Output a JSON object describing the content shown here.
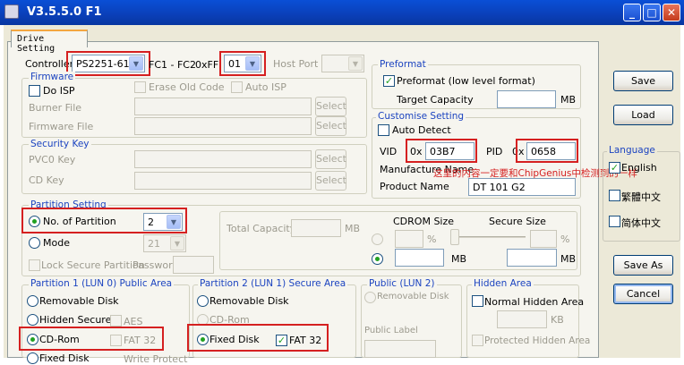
{
  "window": {
    "title": "V3.5.5.0 F1",
    "min": "_",
    "max": "□",
    "close": "✕"
  },
  "tab": {
    "label": "Drive Setting"
  },
  "controller": {
    "label": "Controller",
    "value": "PS2251-61",
    "fc_label": "FC1 - FC2",
    "ff_label": "0xFF",
    "ff_value": "01",
    "host_port_label": "Host Port"
  },
  "firmware": {
    "title": "Firmware",
    "do_isp": "Do ISP",
    "erase_old_code": "Erase Old Code",
    "auto_isp": "Auto ISP",
    "burner_file": "Burner File",
    "firmware_file": "Firmware File",
    "select": "Select"
  },
  "security": {
    "title": "Security Key",
    "pvc0": "PVC0 Key",
    "cd_key": "CD Key",
    "select": "Select"
  },
  "partition": {
    "title": "Partition Setting",
    "no_partition": "No. of Partition",
    "no_value": "2",
    "mode": "Mode",
    "mode_value": "21",
    "lock_secure": "Lock Secure Partition",
    "password": "Password",
    "total_capacity": "Total Capacity",
    "mb": "MB",
    "cdrom_size": "CDROM Size",
    "secure_size": "Secure Size",
    "percent": "%"
  },
  "preformat": {
    "title": "Preformat",
    "option": "Preformat (low level format)",
    "target_capacity": "Target Capacity",
    "mb": "MB"
  },
  "customise": {
    "title": "Customise Setting",
    "auto_detect": "Auto Detect",
    "vid": "VID",
    "vid_prefix": "0x",
    "vid_value": "03B7",
    "pid": "PID",
    "pid_prefix": "0x",
    "pid_value": "0658",
    "manufacture": "Manufacture Name",
    "product_name": "Product Name",
    "product_value": "DT  101  G2",
    "note": "这里的内容一定要和ChipGenius中检测到的一样"
  },
  "lun0": {
    "title": "Partition 1 (LUN 0) Public Area",
    "removable": "Removable Disk",
    "hidden_secure": "Hidden Secure",
    "aes": "AES",
    "cdrom": "CD-Rom",
    "fat32": "FAT 32",
    "fixed_disk": "Fixed Disk",
    "write_protect": "Write Protect"
  },
  "lun1": {
    "title": "Partition 2 (LUN 1) Secure Area",
    "removable": "Removable Disk",
    "cdrom": "CD-Rom",
    "fixed_disk": "Fixed Disk",
    "fat32": "FAT 32"
  },
  "lun2": {
    "title": "Public (LUN 2)",
    "removable": "Removable Disk",
    "public_label": "Public Label"
  },
  "hidden": {
    "title": "Hidden Area",
    "normal": "Normal Hidden Area",
    "kb": "KB",
    "protected": "Protected Hidden Area"
  },
  "buttons": {
    "save": "Save",
    "load": "Load",
    "save_as": "Save As",
    "cancel": "Cancel"
  },
  "language": {
    "title": "Language",
    "english": "English",
    "trad_chinese": "繁體中文",
    "simp_chinese": "简体中文"
  },
  "colors": {
    "highlight": "#d52020",
    "group_title": "#1c44c0",
    "title_bar": "#0a4fd6"
  }
}
